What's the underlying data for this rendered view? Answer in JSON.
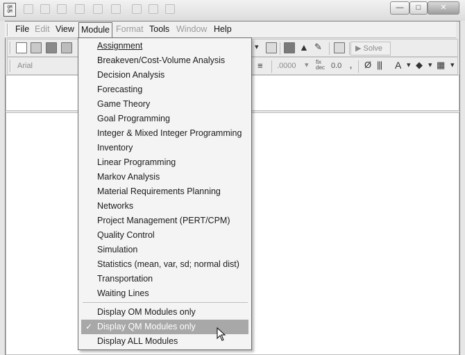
{
  "menubar": {
    "file": "File",
    "edit": "Edit",
    "view": "View",
    "module": "Module",
    "format": "Format",
    "tools": "Tools",
    "window": "Window",
    "help": "Help"
  },
  "toolbar": {
    "solve_label": "Solve",
    "font_name": "Arial",
    "number_format": ".0000",
    "fix_dec": "fix dec",
    "decimal_value": "0.0",
    "comma": ","
  },
  "module_menu": {
    "items": [
      "Assignment",
      "Breakeven/Cost-Volume Analysis",
      "Decision Analysis",
      "Forecasting",
      "Game Theory",
      "Goal Programming",
      "Integer & Mixed Integer Programming",
      "Inventory",
      "Linear Programming",
      "Markov Analysis",
      "Material Requirements Planning",
      "Networks",
      "Project Management (PERT/CPM)",
      "Quality Control",
      "Simulation",
      "Statistics (mean, var, sd; normal dist)",
      "Transportation",
      "Waiting Lines"
    ],
    "display_options": [
      "Display OM Modules only",
      "Display QM Modules only",
      "Display ALL Modules"
    ],
    "checked_option": "Display QM Modules only"
  },
  "icons": {
    "app": "qm-app-icon",
    "new": "new-file-icon",
    "open": "open-folder-icon",
    "save": "save-icon",
    "print": "print-icon",
    "solve": "solve-arrow-icon",
    "window_controls": [
      "minimize-icon",
      "maximize-icon",
      "close-icon"
    ]
  },
  "colors": {
    "highlight": "#a8a8a8",
    "menu_bg": "#f4f4f4"
  }
}
